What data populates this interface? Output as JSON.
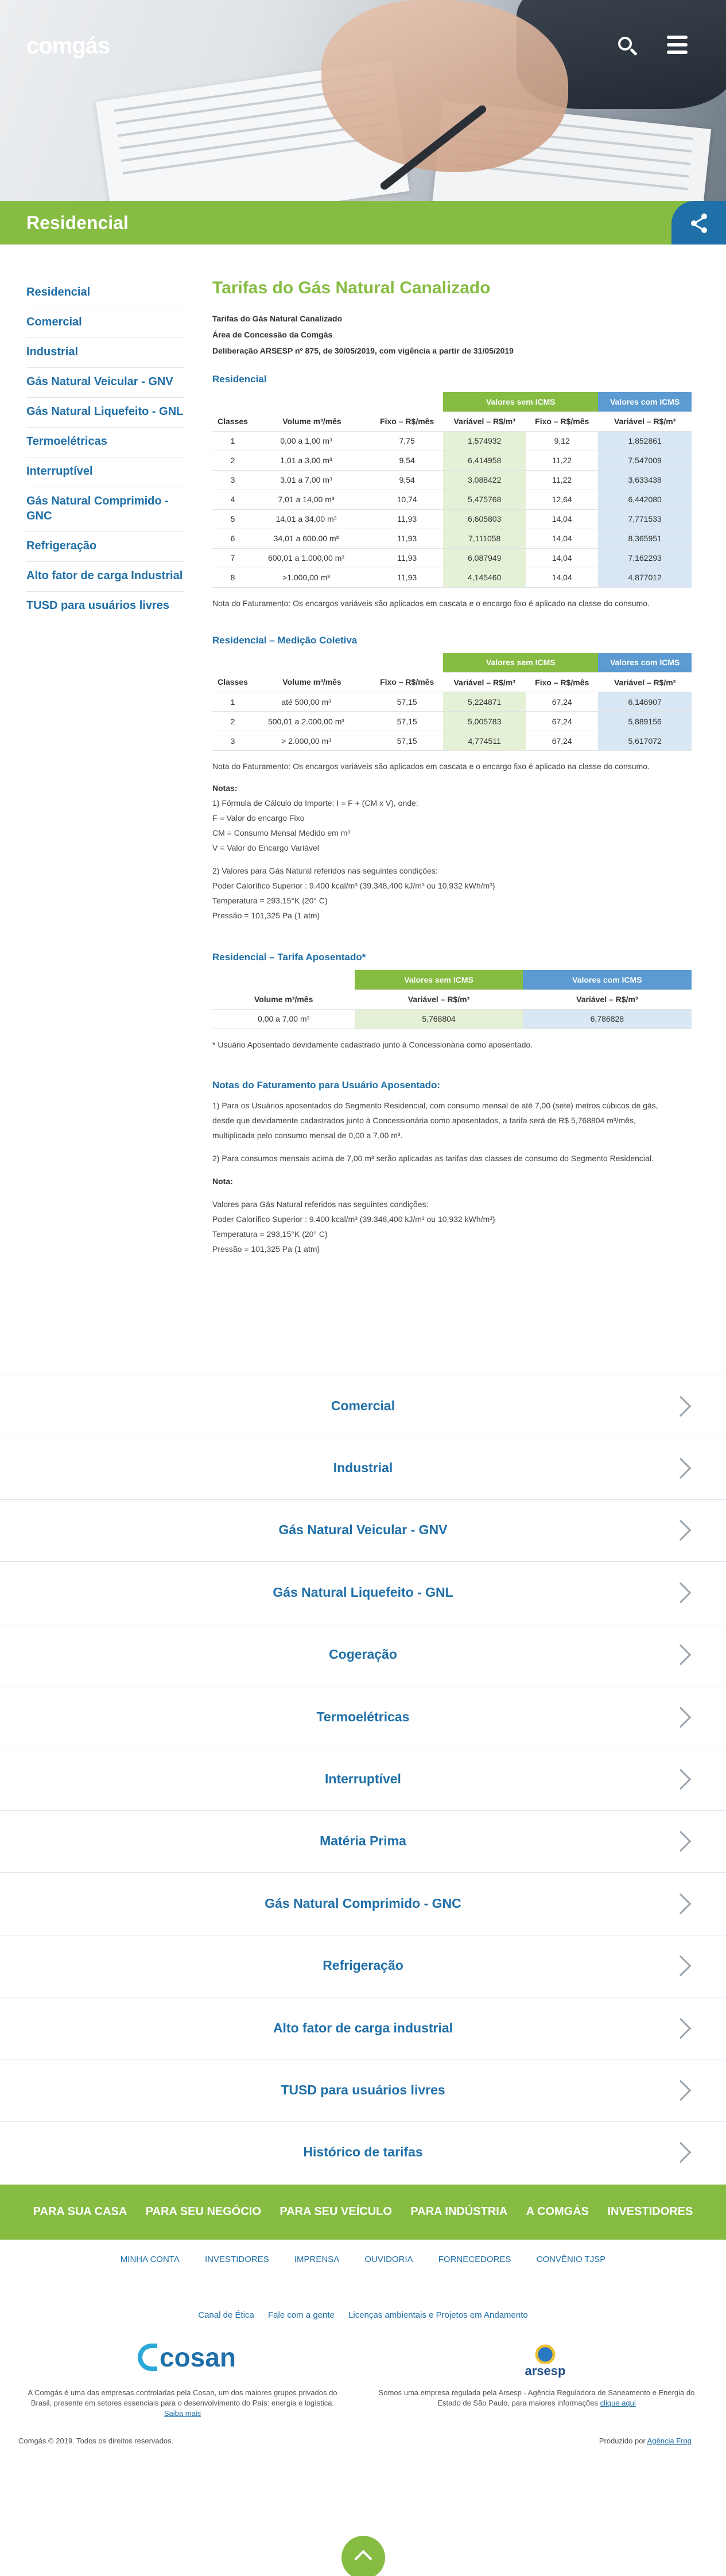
{
  "header": {
    "logo": "comgás",
    "section_title": "Residencial"
  },
  "sidebar": {
    "items": [
      {
        "label": "Residencial"
      },
      {
        "label": "Comercial"
      },
      {
        "label": "Industrial"
      },
      {
        "label": "Gás Natural Veicular - GNV"
      },
      {
        "label": "Gás Natural Liquefeito - GNL"
      },
      {
        "label": "Termoelétricas"
      },
      {
        "label": "Interruptível"
      },
      {
        "label": "Gás Natural Comprimido - GNC"
      },
      {
        "label": "Refrigeração"
      },
      {
        "label": "Alto fator de carga Industrial"
      },
      {
        "label": "TUSD para usuários livres"
      }
    ]
  },
  "main": {
    "title": "Tarifas do Gás Natural Canalizado",
    "meta": {
      "line1": "Tarifas do Gás Natural Canalizado",
      "line2": "Área de Concessão da Comgás",
      "line3": "Deliberação ARSESP nº 875, de 30/05/2019, com vigência a partir de 31/05/2019"
    },
    "table1": {
      "title": "Residencial",
      "group_sem": "Valores sem ICMS",
      "group_com": "Valores com ICMS",
      "headers": [
        "Classes",
        "Volume m³/mês",
        "Fixo – R$/mês",
        "Variável – R$/m³",
        "Fixo – R$/mês",
        "Variável – R$/m³"
      ],
      "rows": [
        [
          "1",
          "0,00 a 1,00 m³",
          "7,75",
          "1,574932",
          "9,12",
          "1,852861"
        ],
        [
          "2",
          "1,01 a 3,00 m³",
          "9,54",
          "6,414958",
          "11,22",
          "7,547009"
        ],
        [
          "3",
          "3,01 a 7,00 m³",
          "9,54",
          "3,088422",
          "11,22",
          "3,633438"
        ],
        [
          "4",
          "7,01 a 14,00 m³",
          "10,74",
          "5,475768",
          "12,64",
          "6,442080"
        ],
        [
          "5",
          "14,01 a 34,00 m³",
          "11,93",
          "6,605803",
          "14,04",
          "7,771533"
        ],
        [
          "6",
          "34,01 a 600,00 m³",
          "11,93",
          "7,111058",
          "14,04",
          "8,365951"
        ],
        [
          "7",
          "600,01 a 1.000,00 m³",
          "11,93",
          "6,087949",
          "14,04",
          "7,162293"
        ],
        [
          "8",
          ">1.000,00 m³",
          "11,93",
          "4,145460",
          "14,04",
          "4,877012"
        ]
      ],
      "note": "Nota do Faturamento: Os encargos variáveis são aplicados em cascata e o encargo fixo é aplicado na classe do consumo."
    },
    "table2": {
      "title": "Residencial – Medição Coletiva",
      "group_sem": "Valores sem ICMS",
      "group_com": "Valores com ICMS",
      "headers": [
        "Classes",
        "Volume m³/mês",
        "Fixo – R$/mês",
        "Variável – R$/m³",
        "Fixo – R$/mês",
        "Variável – R$/m³"
      ],
      "rows": [
        [
          "1",
          "até 500,00 m³",
          "57,15",
          "5,224871",
          "67,24",
          "6,146907"
        ],
        [
          "2",
          "500,01 a 2.000,00 m³",
          "57,15",
          "5,005783",
          "67,24",
          "5,889156"
        ],
        [
          "3",
          "> 2.000,00 m³",
          "57,15",
          "4,774511",
          "67,24",
          "5,617072"
        ]
      ],
      "note": "Nota do Faturamento: Os encargos variáveis são aplicados em cascata e o encargo fixo é aplicado na classe do consumo."
    },
    "notes": {
      "heading": "Notas:",
      "lines": [
        "1) Fórmula de Cálculo do Importe: I = F + (CM x V), onde:",
        "F = Valor do encargo Fixo",
        "CM = Consumo Mensal Medido em m³",
        "V = Valor do Encargo Variável"
      ],
      "lines2": [
        "2) Valores para Gás Natural referidos nas seguintes condições:",
        "Poder Calorífico Superior : 9.400 kcal/m³ (39.348,400 kJ/m³ ou 10,932 kWh/m³)",
        "Temperatura = 293,15°K (20° C)",
        "Pressão = 101,325 Pa (1 atm)"
      ]
    },
    "table3": {
      "title": "Residencial – Tarifa Aposentado*",
      "group_sem": "Valores sem ICMS",
      "group_com": "Valores com ICMS",
      "headers": [
        "Volume m³/mês",
        "Variável – R$/m³",
        "Variável – R$/m³"
      ],
      "row": [
        "0,00 a 7,00 m³",
        "5,768804",
        "6,786828"
      ],
      "note": "* Usuário Aposentado devidamente cadastrado junto à Concessionária como aposentado."
    },
    "faturamento": {
      "title": "Notas do Faturamento para Usuário Aposentado:",
      "p1_a": "1) Para os Usuários aposentados do Segmento Residencial, com consumo mensal de até 7,00 (sete) metros cúbicos de gás,",
      "p1_b": "desde que devidamente cadastrados junto à Concessionária como aposentados, a tarifa será de R$ 5,768804 m³/mês,",
      "p1_c": "multiplicada pelo consumo mensal de 0,00 a 7,00 m³.",
      "p2": "2) Para consumos mensais acima de 7,00 m³ serão aplicadas as tarifas das classes de consumo do Segmento Residencial.",
      "nota": "Nota:",
      "l1": "Valores para Gás Natural referidos nas seguintes condições:",
      "l2": "Poder Calorífico Superior : 9.400 kcal/m³ (39.348,400 kJ/m³ ou 10,932 kWh/m³)",
      "l3": "Temperatura = 293,15°K (20° C)",
      "l4": "Pressão = 101,325 Pa (1 atm)"
    }
  },
  "accordion": [
    {
      "label": "Comercial"
    },
    {
      "label": "Industrial"
    },
    {
      "label": "Gás Natural Veicular - GNV"
    },
    {
      "label": "Gás Natural Liquefeito - GNL"
    },
    {
      "label": "Cogeração"
    },
    {
      "label": "Termoelétricas"
    },
    {
      "label": "Interruptível"
    },
    {
      "label": "Matéria Prima"
    },
    {
      "label": "Gás Natural Comprimido - GNC"
    },
    {
      "label": "Refrigeração"
    },
    {
      "label": "Alto fator de carga industrial"
    },
    {
      "label": "TUSD para usuários livres"
    },
    {
      "label": "Histórico de tarifas"
    }
  ],
  "footer": {
    "nav": [
      "PARA SUA CASA",
      "PARA SEU NEGÓCIO",
      "PARA SEU VEÍCULO",
      "PARA INDÚSTRIA",
      "A COMGÁS",
      "INVESTIDORES"
    ],
    "links": [
      "MINHA CONTA",
      "INVESTIDORES",
      "IMPRENSA",
      "OUVIDORIA",
      "FORNECEDORES",
      "CONVÊNIO TJSP"
    ],
    "links2": [
      "Canal de Ética",
      "Fale com a gente",
      "Licenças ambientais e Projetos em Andamento"
    ],
    "cosan_logo": "cosan",
    "cosan_text": "A Comgás é uma das empresas controladas pela Cosan, um dos maiores grupos privados do Brasil, presente em setores essenciais para o desenvolvimento do País: energia e logística.",
    "cosan_link": "Saiba mais",
    "arsesp_logo": "arsesp",
    "arsesp_text": "Somos uma empresa regulada pela Arsesp - Agência Reguladora de Saneamento e Energia do Estado de São Paulo, para maiores informações",
    "arsesp_link": "clique aqui",
    "copyright": "Comgás © 2019. Todos os direitos reservados.",
    "produced": "Produzido por",
    "produced_link": "Agência Frog"
  },
  "colors": {
    "green": "#86bc42",
    "blue": "#1f6fa8",
    "light_green": "#e4f1d6",
    "light_blue": "#d8e7f3"
  }
}
